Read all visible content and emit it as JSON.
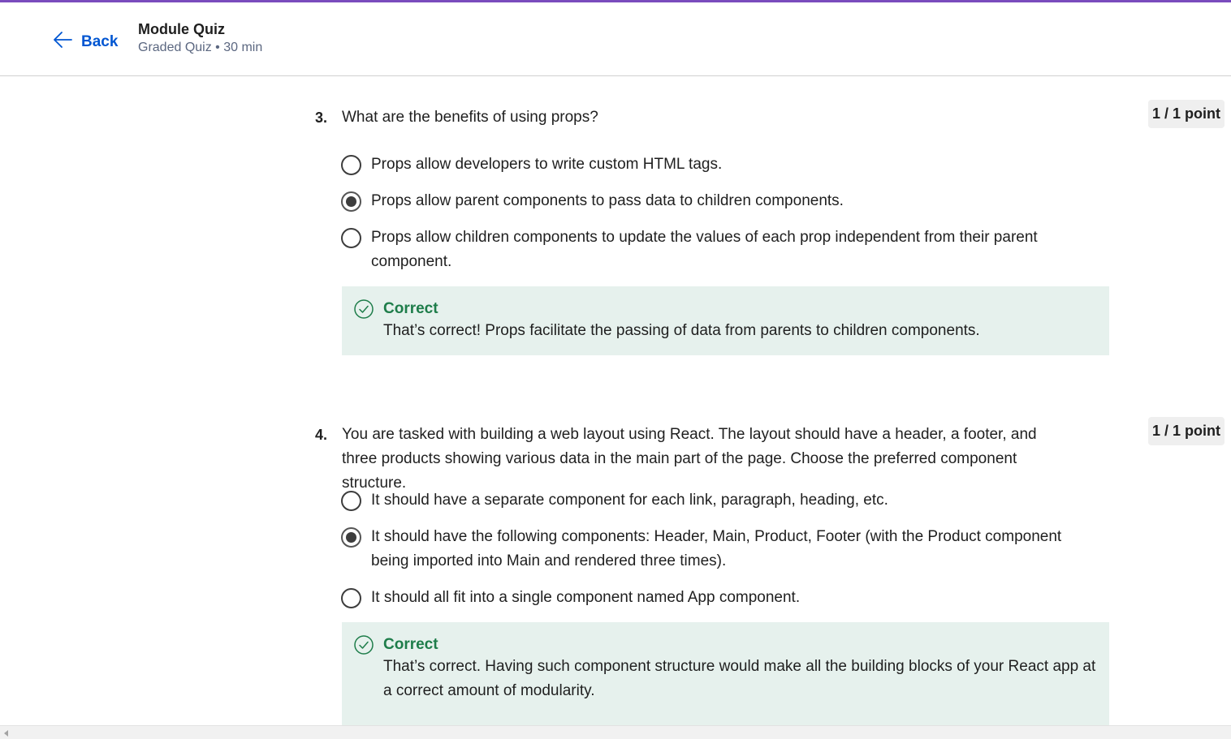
{
  "header": {
    "back_label": "Back",
    "title": "Module Quiz",
    "subtitle": "Graded Quiz • 30 min"
  },
  "questions": [
    {
      "number": "3.",
      "text": "What are the benefits of using props?",
      "points": "1 / 1 point",
      "options": [
        {
          "label": "Props allow developers to write custom HTML tags.",
          "selected": false
        },
        {
          "label": "Props allow parent components to pass data to children components.",
          "selected": true
        },
        {
          "label": "Props allow children components to update the values of each prop independent from their parent component.",
          "selected": false
        }
      ],
      "feedback": {
        "title": "Correct",
        "text": "That’s correct! Props facilitate the passing of data from parents to children components."
      }
    },
    {
      "number": "4.",
      "text": "You are tasked with building a web layout using React. The layout should have a header, a footer, and three products showing various data in the main part of the page. Choose the preferred component structure.",
      "points": "1 / 1 point",
      "options": [
        {
          "label": "It should have a separate component for each link, paragraph, heading, etc.",
          "selected": false
        },
        {
          "label": "It should have the following components: Header, Main, Product, Footer (with the Product component being imported into Main and rendered three times).",
          "selected": true
        },
        {
          "label": "It should all fit into a single component named App component.",
          "selected": false
        }
      ],
      "feedback": {
        "title": "Correct",
        "text": "That’s correct. Having such component structure would make all the building blocks of your React app at a correct amount of modularity."
      }
    }
  ],
  "colors": {
    "accent": "#7a4cbd",
    "link": "#0056d2",
    "correct": "#1e7d4a",
    "feedback_bg": "#e6f1ed"
  },
  "icons": {
    "back": "arrow-left-icon",
    "feedback": "check-circle-icon"
  }
}
